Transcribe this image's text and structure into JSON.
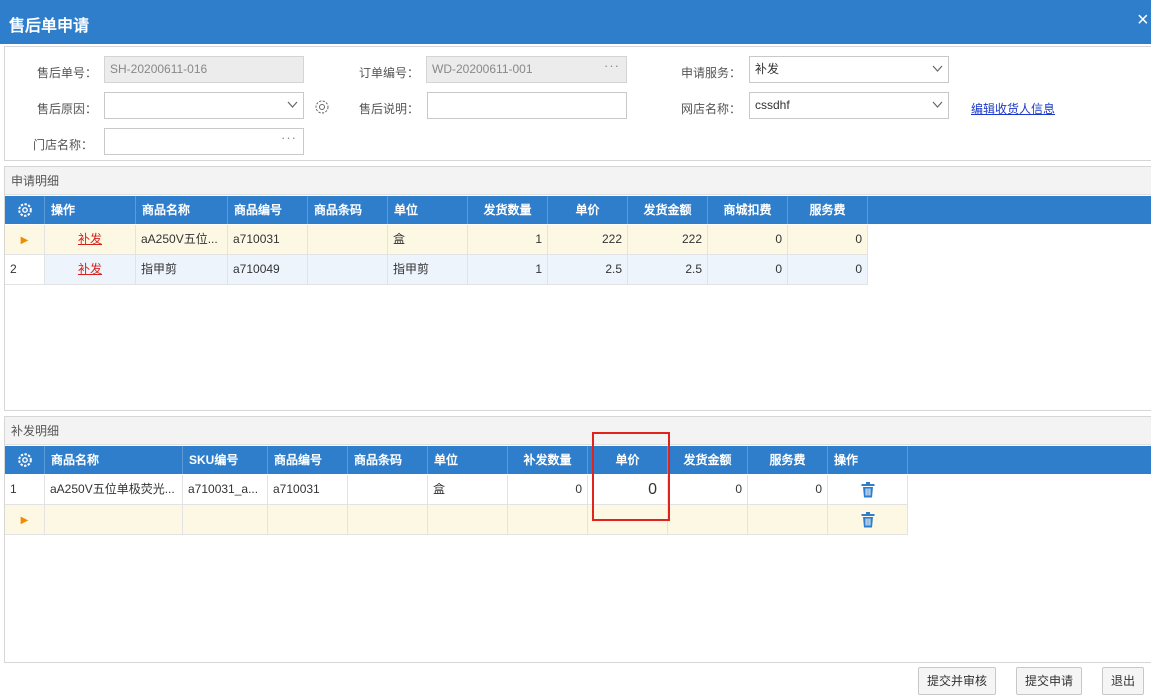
{
  "window": {
    "title": "售后单申请",
    "close": "×"
  },
  "form": {
    "after_sale_no": {
      "label": "售后单号：",
      "value": "SH-20200611-016"
    },
    "order_no": {
      "label": "订单编号：",
      "value": "WD-20200611-001"
    },
    "service": {
      "label": "申请服务：",
      "value": "补发"
    },
    "reason": {
      "label": "售后原因：",
      "value": ""
    },
    "remark": {
      "label": "售后说明：",
      "value": ""
    },
    "shop": {
      "label": "网店名称：",
      "value": "cssdhf"
    },
    "store": {
      "label": "门店名称：",
      "value": ""
    },
    "edit_receiver_link": "编辑收货人信息"
  },
  "apply_detail": {
    "title": "申请明细",
    "columns": [
      "操作",
      "商品名称",
      "商品编号",
      "商品条码",
      "单位",
      "发货数量",
      "单价",
      "发货金额",
      "商城扣费",
      "服务费"
    ],
    "rows": [
      {
        "indicator": "▶",
        "action": "补发",
        "name": "aA250V五位...",
        "code": "a710031",
        "barcode": "",
        "unit": "盒",
        "qty": "1",
        "price": "222",
        "amount": "222",
        "deduction": "0",
        "fee": "0"
      },
      {
        "indicator": "2",
        "action": "补发",
        "name": "指甲剪",
        "code": "a710049",
        "barcode": "",
        "unit": "指甲剪",
        "qty": "1",
        "price": "2.5",
        "amount": "2.5",
        "deduction": "0",
        "fee": "0"
      }
    ]
  },
  "resend_detail": {
    "title": "补发明细",
    "columns": [
      "商品名称",
      "SKU编号",
      "商品编号",
      "商品条码",
      "单位",
      "补发数量",
      "单价",
      "发货金额",
      "服务费",
      "操作"
    ],
    "rows": [
      {
        "indicator": "1",
        "name": "aA250V五位单极荧光...",
        "sku": "a710031_a...",
        "code": "a710031",
        "barcode": "",
        "unit": "盒",
        "qty": "0",
        "price": "0",
        "amount": "0",
        "fee": "0"
      },
      {
        "indicator": "▶",
        "name": "",
        "sku": "",
        "code": "",
        "barcode": "",
        "unit": "",
        "qty": "",
        "price": "",
        "amount": "",
        "fee": ""
      }
    ]
  },
  "buttons": {
    "submit_review": "提交并审核",
    "submit": "提交申请",
    "exit": "退出"
  },
  "colors": {
    "header_blue": "#2f7ecb",
    "highlight_red": "#e0231c",
    "link_red": "#d9211b",
    "link_blue": "#1a39c9"
  }
}
